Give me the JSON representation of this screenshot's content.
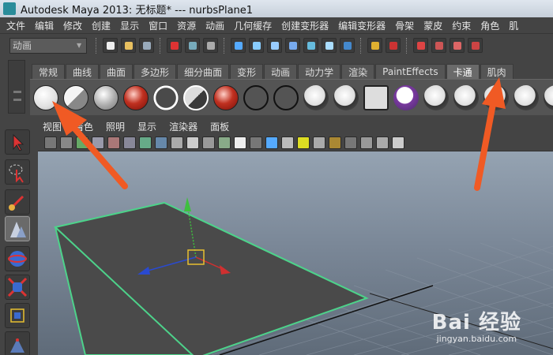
{
  "window": {
    "title": "Autodesk Maya 2013: 无标题*   ---   nurbsPlane1"
  },
  "menubar": {
    "items": [
      "文件",
      "编辑",
      "修改",
      "创建",
      "显示",
      "窗口",
      "资源",
      "动画",
      "几何缓存",
      "创建变形器",
      "编辑变形器",
      "骨架",
      "蒙皮",
      "约束",
      "角色",
      "肌"
    ]
  },
  "statusline": {
    "mode": "动画"
  },
  "shelf": {
    "tabs": [
      "常规",
      "曲线",
      "曲面",
      "多边形",
      "细分曲面",
      "变形",
      "动画",
      "动力学",
      "渲染",
      "PaintEffects",
      "卡通",
      "肌肉"
    ],
    "active_tab": "卡通"
  },
  "panel": {
    "menus": [
      "视图",
      "着色",
      "照明",
      "显示",
      "渲染器",
      "面板"
    ]
  },
  "colors": {
    "selection_outline": "#4dd28a",
    "arrow_annotation": "#f05a24",
    "plane": "#4a4a4a"
  },
  "watermark": {
    "brand": "Bai 经验",
    "url": "jingyan.baidu.com"
  }
}
